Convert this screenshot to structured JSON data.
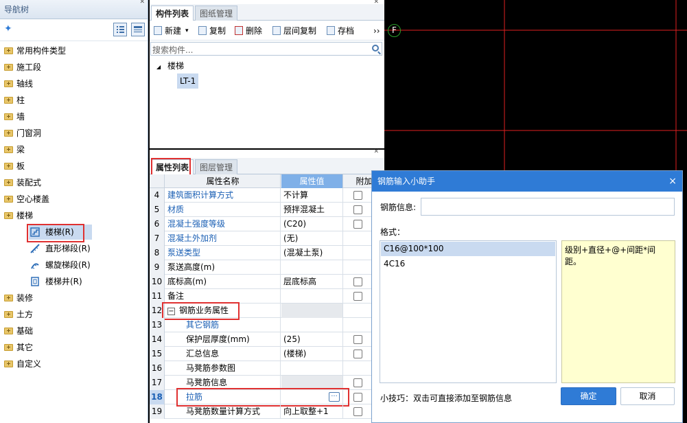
{
  "nav": {
    "title": "导航树",
    "items": [
      {
        "label": "常用构件类型"
      },
      {
        "label": "施工段"
      },
      {
        "label": "轴线"
      },
      {
        "label": "柱"
      },
      {
        "label": "墙"
      },
      {
        "label": "门窗洞"
      },
      {
        "label": "梁"
      },
      {
        "label": "板"
      },
      {
        "label": "装配式"
      },
      {
        "label": "空心楼盖"
      },
      {
        "label": "楼梯",
        "children": [
          "楼梯(R)",
          "直形梯段(R)",
          "螺旋梯段(R)",
          "楼梯井(R)"
        ]
      },
      {
        "label": "装修"
      },
      {
        "label": "土方"
      },
      {
        "label": "基础"
      },
      {
        "label": "其它"
      },
      {
        "label": "自定义"
      }
    ]
  },
  "component_panel": {
    "tabs": [
      "构件列表",
      "图纸管理"
    ],
    "toolbar": [
      "新建",
      "复制",
      "删除",
      "层间复制",
      "存档"
    ],
    "more": "››",
    "search_placeholder": "搜索构件...",
    "tree_group": "楼梯",
    "tree_item": "LT-1"
  },
  "property_panel": {
    "tabs": [
      "属性列表",
      "图层管理"
    ],
    "headers": {
      "name": "属性名称",
      "value": "属性值",
      "extra": "附加"
    },
    "rows": [
      {
        "num": "4",
        "name": "建筑面积计算方式",
        "value": "不计算"
      },
      {
        "num": "5",
        "name": "材质",
        "value": "预拌混凝土"
      },
      {
        "num": "6",
        "name": "混凝土强度等级",
        "value": "(C20)"
      },
      {
        "num": "7",
        "name": "混凝土外加剂",
        "value": "(无)"
      },
      {
        "num": "8",
        "name": "泵送类型",
        "value": "(混凝土泵)"
      },
      {
        "num": "9",
        "name": "泵送高度(m)",
        "value": ""
      },
      {
        "num": "10",
        "name": "底标高(m)",
        "value": "层底标高"
      },
      {
        "num": "11",
        "name": "备注",
        "value": ""
      },
      {
        "num": "12",
        "name": "钢筋业务属性",
        "value": ""
      },
      {
        "num": "13",
        "name": "其它钢筋",
        "value": ""
      },
      {
        "num": "14",
        "name": "保护层厚度(mm)",
        "value": "(25)"
      },
      {
        "num": "15",
        "name": "汇总信息",
        "value": "(楼梯)"
      },
      {
        "num": "16",
        "name": "马凳筋参数图",
        "value": ""
      },
      {
        "num": "17",
        "name": "马凳筋信息",
        "value": ""
      },
      {
        "num": "18",
        "name": "拉筋",
        "value": ""
      },
      {
        "num": "19",
        "name": "马凳筋数量计算方式",
        "value": "向上取整+1"
      }
    ],
    "collapse_symbol": "−",
    "ellipsis": "···"
  },
  "canvas": {
    "axis_label": "F"
  },
  "dialog": {
    "title": "钢筋输入小助手",
    "close": "×",
    "info_label": "钢筋信息:",
    "info_value": "",
    "format_label": "格式：",
    "formats": [
      "C16@100*100",
      "4C16"
    ],
    "hint_text": "级别+直径+@+间距*间距。",
    "tip": "小技巧：双击可直接添加至钢筋信息",
    "ok": "确定",
    "cancel": "取消"
  }
}
